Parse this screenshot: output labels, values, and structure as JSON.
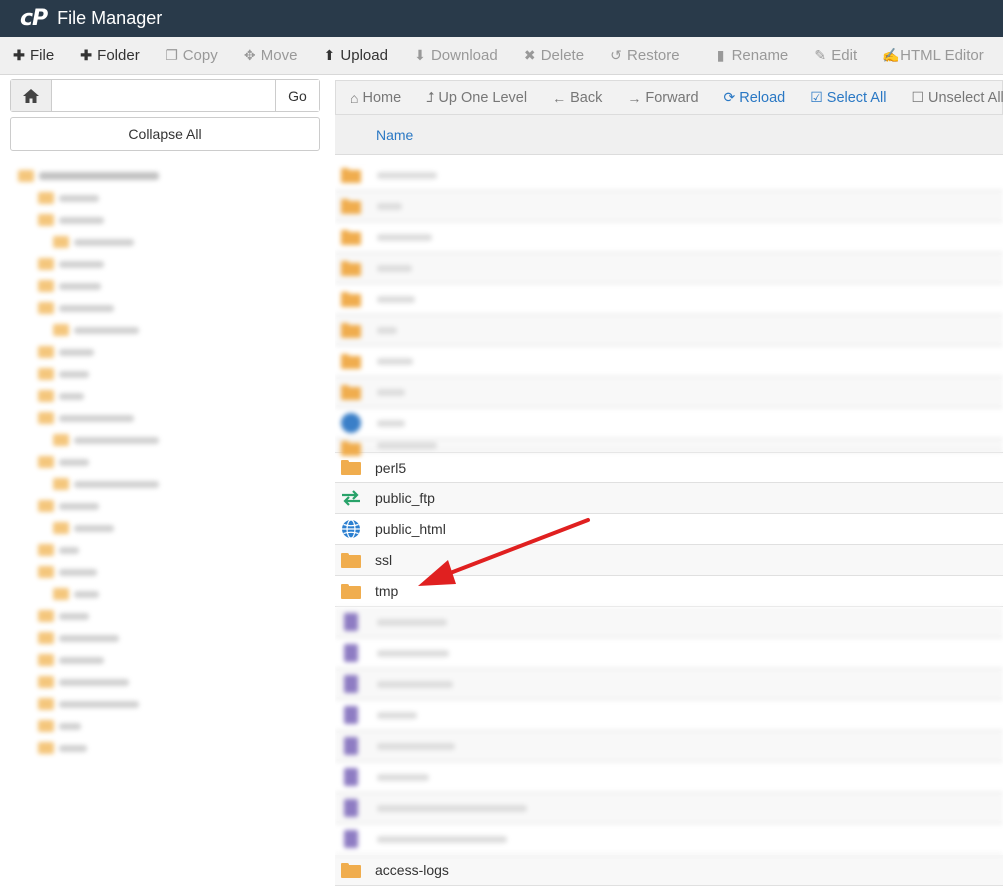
{
  "header": {
    "logo": "cP",
    "title": "File Manager"
  },
  "toolbar": {
    "file": "File",
    "folder": "Folder",
    "copy": "Copy",
    "move": "Move",
    "upload": "Upload",
    "download": "Download",
    "delete": "Delete",
    "restore": "Restore",
    "rename": "Rename",
    "edit": "Edit",
    "html_editor": "HTML Editor"
  },
  "left": {
    "path_value": "",
    "go_label": "Go",
    "collapse_label": "Collapse All"
  },
  "nav": {
    "home": "Home",
    "up_one_level": "Up One Level",
    "back": "Back",
    "forward": "Forward",
    "reload": "Reload",
    "select_all": "Select All",
    "unselect_all": "Unselect All"
  },
  "list": {
    "column_name": "Name",
    "visible_items": [
      {
        "name": "perl5",
        "icon": "folder-icon"
      },
      {
        "name": "public_ftp",
        "icon": "transfer-icon"
      },
      {
        "name": "public_html",
        "icon": "globe-icon"
      },
      {
        "name": "ssl",
        "icon": "folder-icon"
      },
      {
        "name": "tmp",
        "icon": "folder-icon"
      }
    ],
    "last_item": "access-logs"
  },
  "colors": {
    "header_bg": "#293a4a",
    "accent": "#2a78c4",
    "folder": "#f0ad4e",
    "arrow": "#e02020"
  }
}
